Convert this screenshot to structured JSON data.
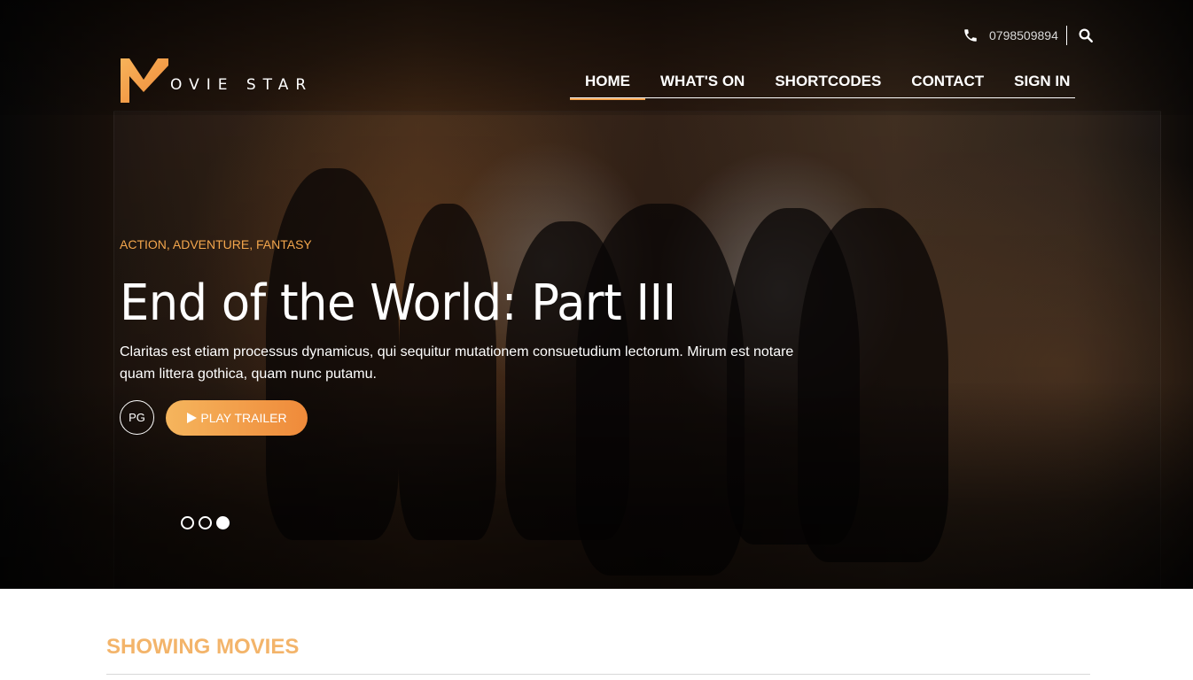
{
  "header": {
    "logo_text": "OVIE STAR",
    "phone": "0798509894",
    "nav": [
      {
        "label": "HOME",
        "active": true
      },
      {
        "label": "WHAT'S ON",
        "active": false
      },
      {
        "label": "SHORTCODES",
        "active": false
      },
      {
        "label": "CONTACT",
        "active": false
      },
      {
        "label": "SIGN IN",
        "active": false
      }
    ]
  },
  "hero": {
    "genres": "ACTION, ADVENTURE, FANTASY",
    "title": "End of the World: Part III",
    "description_line1": "Claritas est etiam processus dynamicus, qui sequitur mutationem consuetudium lectorum. Mirum est notare",
    "description_line2": "quam littera gothica, quam nunc putamu.",
    "rating": "PG",
    "play_label": "PLAY TRAILER",
    "slides": 3,
    "active_slide": 3
  },
  "section": {
    "title": "SHOWING MOVIES"
  },
  "colors": {
    "accent": "#f0a04b",
    "button_start": "#f5b55d",
    "button_end": "#ef8a3a"
  },
  "icons": [
    "logo-m-icon",
    "phone-icon",
    "search-icon",
    "play-icon"
  ]
}
